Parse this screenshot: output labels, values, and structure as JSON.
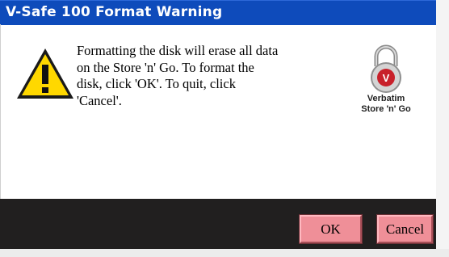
{
  "window": {
    "title": "V-Safe 100 Format Warning"
  },
  "message": {
    "lines": [
      "Formatting the disk will erase all data",
      "on the Store 'n' Go.  To format the",
      "disk, click 'OK'.  To quit, click",
      "'Cancel'."
    ]
  },
  "brand": {
    "name": "Verbatim",
    "product": "Store 'n' Go",
    "icon": "padlock-icon"
  },
  "icons": {
    "warning": "warning-triangle-icon"
  },
  "buttons": {
    "ok_label": "OK",
    "cancel_label": "Cancel"
  },
  "colors": {
    "titlebar": "#0e4bbb",
    "footer": "#211f1f",
    "button": "#ef8f98",
    "warning_yellow": "#ffd800",
    "brand_red": "#c8202a"
  }
}
